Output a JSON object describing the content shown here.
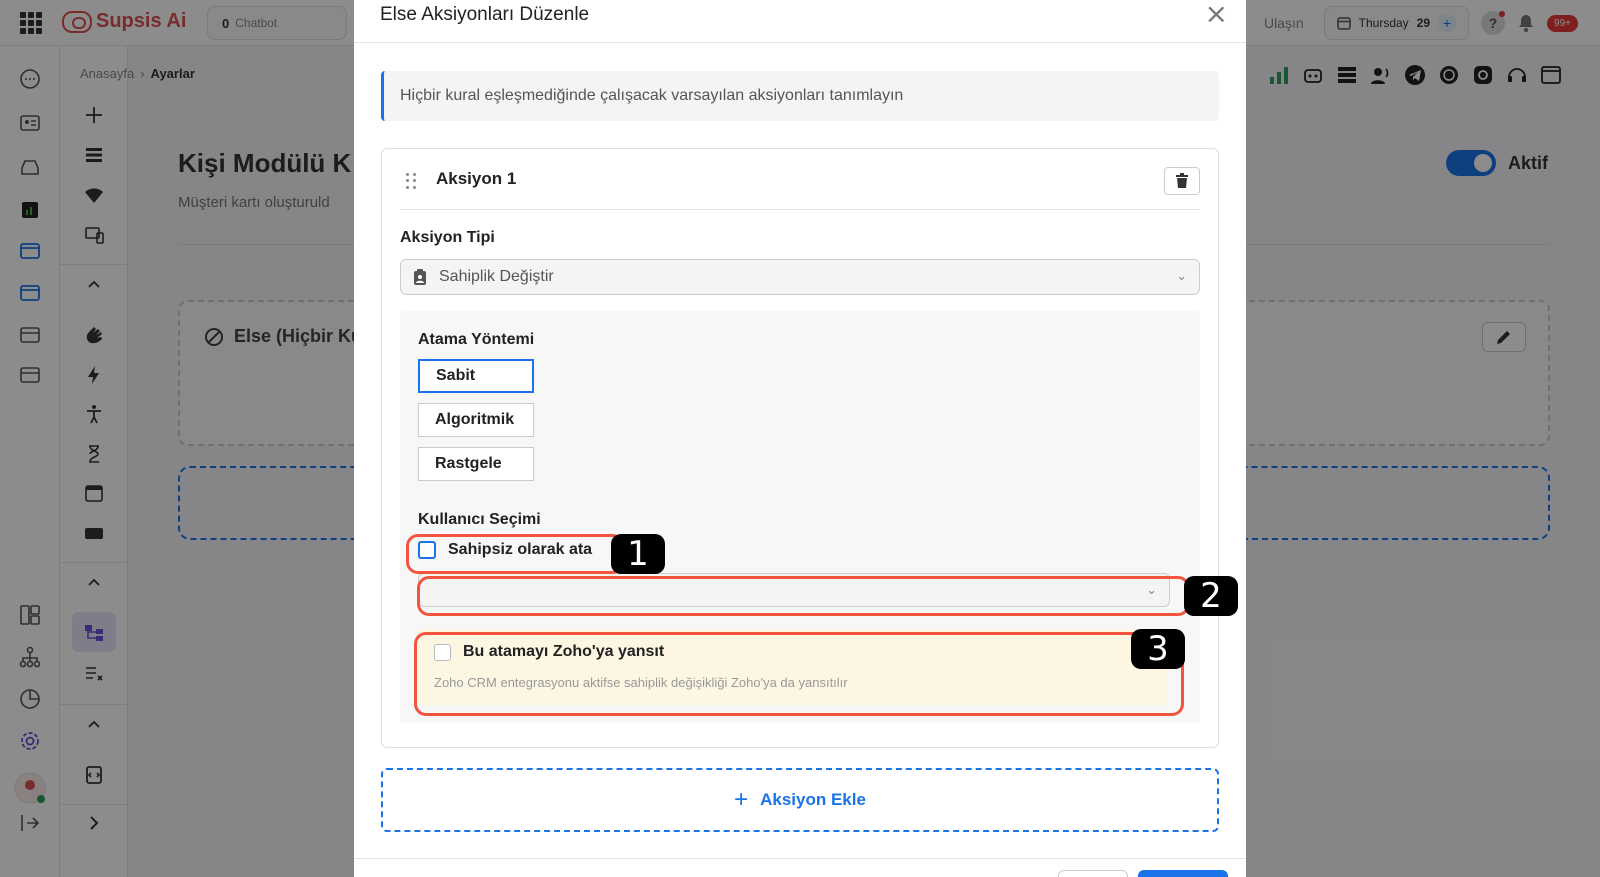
{
  "app": {
    "logo_text": "Supsis Ai",
    "chatbot_count": "0",
    "chatbot_label": "Chatbot",
    "ulasin": "Ulaşın",
    "date_day": "Thursday",
    "date_num": "29",
    "notif_badge": "99+"
  },
  "breadcrumb": {
    "home": "Anasayfa",
    "separator": "›",
    "current": "Ayarlar"
  },
  "page": {
    "title": "Kişi Modülü K",
    "subtitle": "Müşteri kartı oluşturuld",
    "toggle_label": "Aktif",
    "else_label": "Else (Hiçbir Ku"
  },
  "modal": {
    "title": "Else Aksiyonları Düzenle",
    "close_glyph": "×",
    "info": "Hiçbir kural eşleşmediğinde çalışacak varsayılan aksiyonları tanımlayın",
    "action": {
      "title": "Aksiyon 1",
      "type_label": "Aksiyon Tipi",
      "type_value": "Sahiplik Değiştir",
      "assign_label": "Atama Yöntemi",
      "assign_options": [
        "Sabit",
        "Algoritmik",
        "Rastgele"
      ],
      "assign_selected": "Sabit",
      "user_label": "Kullanıcı Seçimi",
      "unassigned_label": "Sahipsiz olarak ata",
      "zoho_label": "Bu atamayı Zoho'ya yansıt",
      "zoho_desc": "Zoho CRM entegrasyonu aktifse sahiplik değişikliği Zoho'ya da yansıtılır"
    },
    "add_action": "Aksiyon Ekle",
    "add_plus": "+"
  },
  "annotations": [
    "1",
    "2",
    "3"
  ],
  "colors": {
    "accent": "#1a73e8",
    "highlight": "#f2543f",
    "brand": "#d9534f"
  }
}
